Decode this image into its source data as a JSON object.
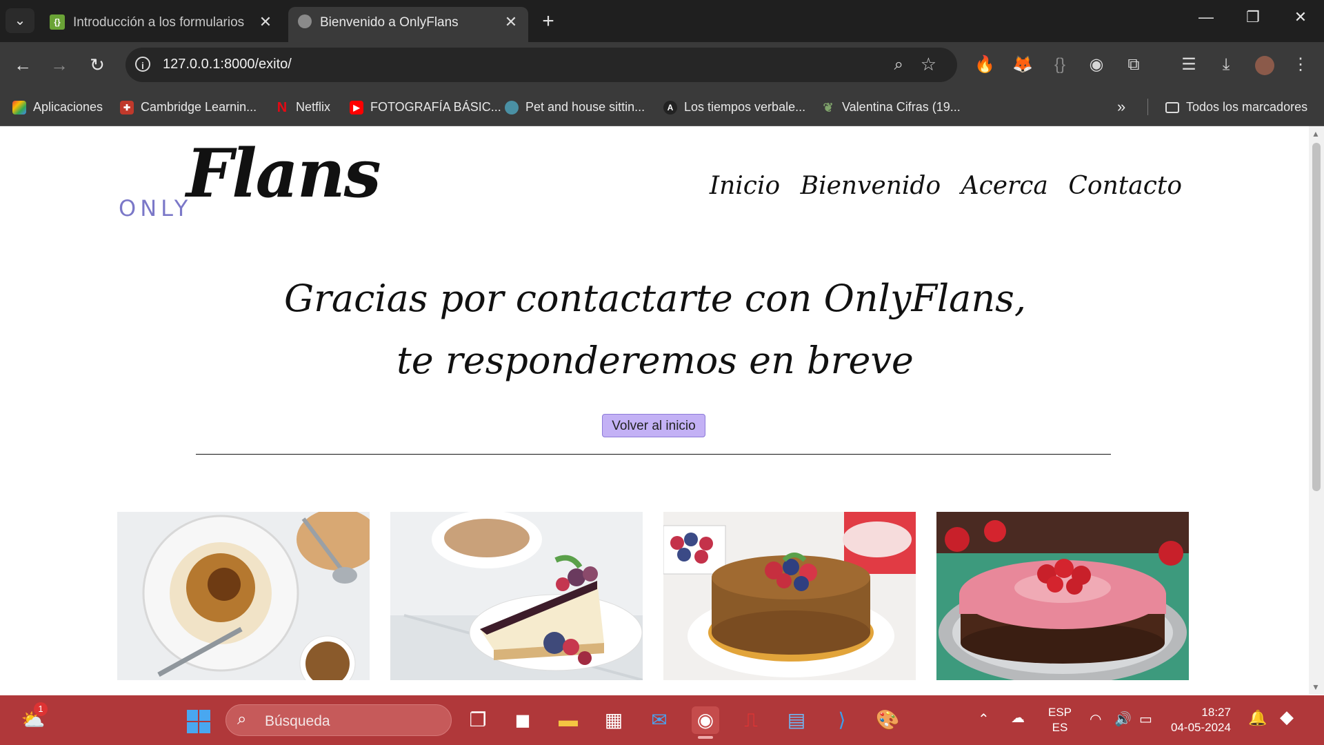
{
  "browser": {
    "tabs": [
      {
        "title": "Introducción a los formularios / ",
        "active": false
      },
      {
        "title": "Bienvenido a OnlyFlans",
        "active": true
      }
    ],
    "url": "127.0.0.1:8000/exito/",
    "bookmarks": [
      {
        "label": "Aplicaciones",
        "icon": "apps-grid-icon"
      },
      {
        "label": "Cambridge Learnin...",
        "icon": "cambridge-icon"
      },
      {
        "label": "Netflix",
        "icon": "netflix-icon"
      },
      {
        "label": "FOTOGRAFÍA BÁSIC...",
        "icon": "youtube-icon"
      },
      {
        "label": "Pet and house sittin...",
        "icon": "globe-icon"
      },
      {
        "label": "Los tiempos verbale...",
        "icon": "letter-a-icon"
      },
      {
        "label": "Valentina Cifras (19...",
        "icon": "tree-icon"
      }
    ],
    "all_bookmarks_label": "Todos los marcadores"
  },
  "page": {
    "logo": {
      "only": "ONLY",
      "flans": "Flans"
    },
    "nav": [
      "Inicio",
      "Bienvenido",
      "Acerca",
      "Contacto"
    ],
    "thanks_line1": "Gracias por contactarte con OnlyFlans,",
    "thanks_line2": "te responderemos en breve",
    "back_button": "Volver al inicio",
    "photos": [
      "flan-with-caramel-photo",
      "cheesecake-with-berries-photo",
      "flan-with-fruit-photo",
      "strawberry-gelatin-cake-photo"
    ]
  },
  "taskbar": {
    "search_placeholder": "Búsqueda",
    "weather_badge": "1",
    "lang_top": "ESP",
    "lang_bottom": "ES",
    "time": "18:27",
    "date": "04-05-2024"
  },
  "colors": {
    "taskbar": "#b0383a",
    "button": "#c3b1f5",
    "logo_only": "#7b78c8"
  }
}
